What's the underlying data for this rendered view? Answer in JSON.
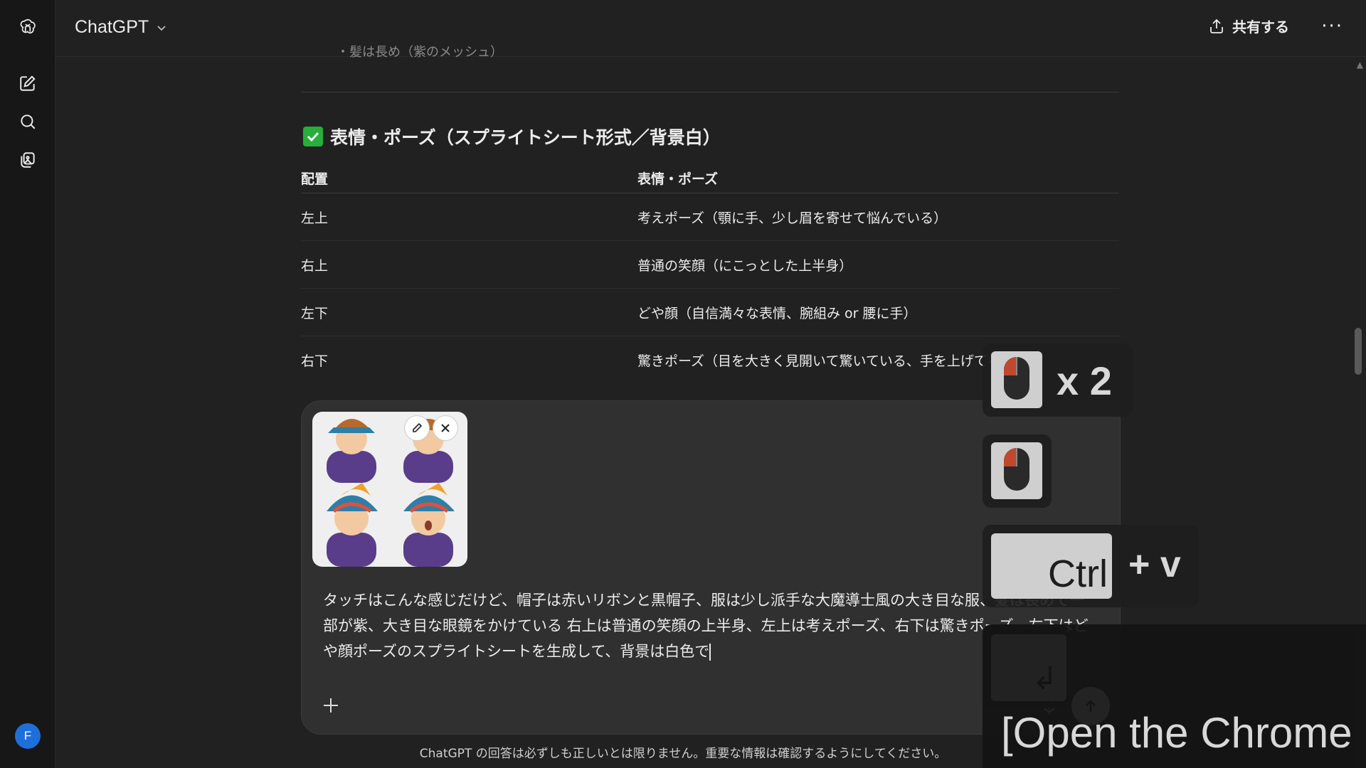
{
  "header": {
    "model_label": "ChatGPT",
    "share_label": "共有する",
    "more_label": "···"
  },
  "sidebar": {
    "avatar_initial": "F"
  },
  "content": {
    "partial_text": "・髪は長め（紫のメッシュ）",
    "section_title": "表情・ポーズ（スプライトシート形式／背景白）",
    "table": {
      "headers": [
        "配置",
        "表情・ポーズ"
      ],
      "rows": [
        [
          "左上",
          "考えポーズ（顎に手、少し眉を寄せて悩んでいる）"
        ],
        [
          "右上",
          "普通の笑顔（にこっとした上半身）"
        ],
        [
          "左下",
          "どや顔（自信満々な表情、腕組み or 腰に手）"
        ],
        [
          "右下",
          "驚きポーズ（目を大きく見開いて驚いている、手を上げてる）"
        ]
      ]
    }
  },
  "composer": {
    "prompt_text": "タッチはこんな感じだけど、帽子は赤いリボンと黒帽子、服は少し派手な大魔導士風の大き目な服、髪は長めで一部が紫、大き目な眼鏡をかけている 右上は普通の笑顔の上半身、左上は考えポーズ、右下は驚きポーズ、左下はどや顔ポーズのスプライトシートを生成して、背景は白色で"
  },
  "footer": {
    "disclaimer": "ChatGPT の回答は必ずしも正しいとは限りません。重要な情報は確認するようにしてください。"
  },
  "overlay": {
    "double_click_label": "x 2",
    "ctrl_label": "Ctrl",
    "plus_v_label": "+ v",
    "enter_label": "↲",
    "caption": "[Open the Chrome"
  },
  "colors": {
    "background": "#212121",
    "sidebar": "#171717",
    "composer": "#303030",
    "check_green": "#27ae3b",
    "avatar_blue": "#1e6fd9",
    "mouse_red": "#c0482e"
  }
}
